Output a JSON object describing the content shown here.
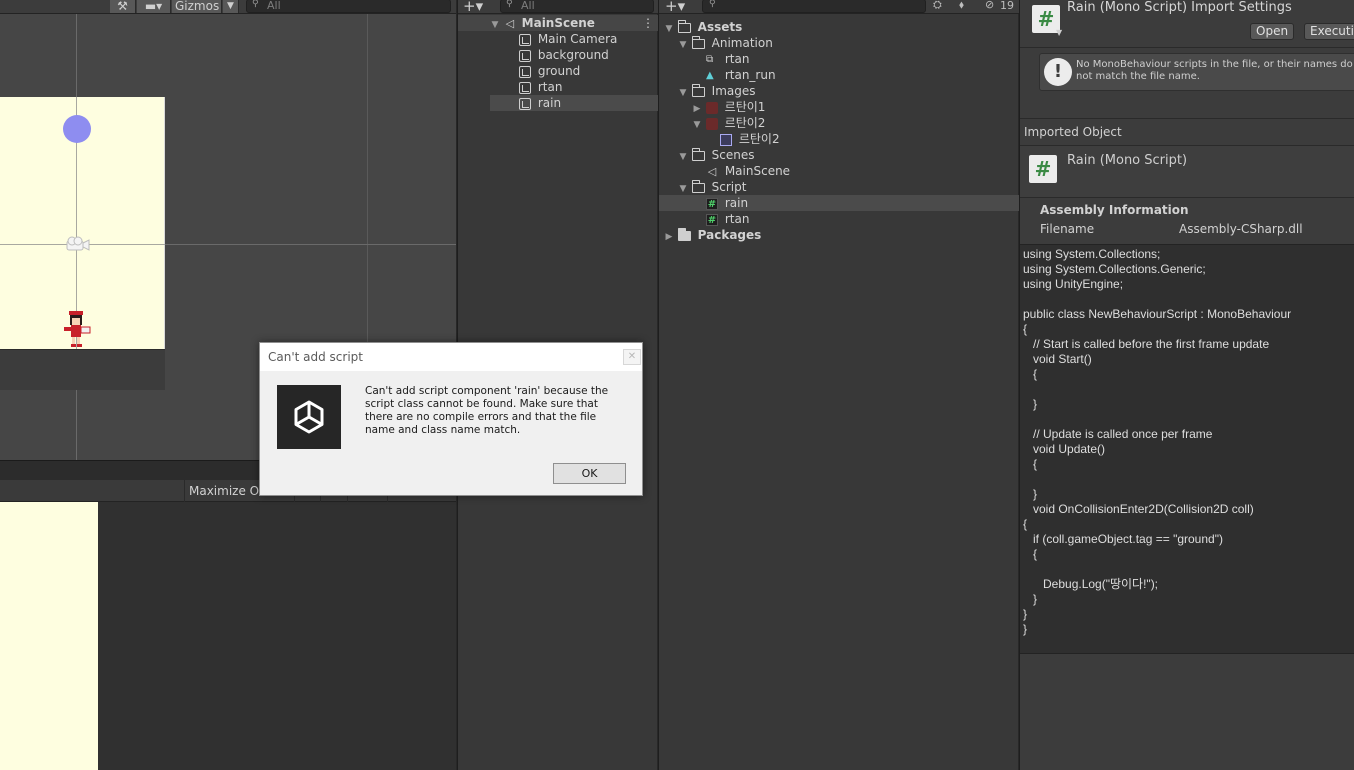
{
  "scene_toolbar": {
    "gizmos_label": "Gizmos",
    "search_placeholder": "All"
  },
  "game_toolbar": {
    "maximize_label": "Maximize On"
  },
  "hierarchy": {
    "search_placeholder": "All",
    "scene_name": "MainScene",
    "items": [
      {
        "label": "Main Camera"
      },
      {
        "label": "background"
      },
      {
        "label": "ground"
      },
      {
        "label": "rtan"
      },
      {
        "label": "rain"
      }
    ]
  },
  "project": {
    "hidden_count": "19",
    "tree": {
      "assets": "Assets",
      "animation": "Animation",
      "anim_rtan": "rtan",
      "anim_rtan_run": "rtan_run",
      "images": "Images",
      "img1": "르탄이1",
      "img2": "르탄이2",
      "img2_sprite": "르탄이2",
      "scenes": "Scenes",
      "mainscene": "MainScene",
      "script": "Script",
      "script_rain": "rain",
      "script_rtan": "rtan",
      "packages": "Packages"
    }
  },
  "inspector": {
    "title": "Rain (Mono Script) Import Settings",
    "open_label": "Open",
    "execution_label": "Execution",
    "warning": "No MonoBehaviour scripts in the file, or their names do not match the file name.",
    "imported_object_header": "Imported Object",
    "object_name": "Rain (Mono Script)",
    "assembly_header": "Assembly Information",
    "filename_label": "Filename",
    "filename_value": "Assembly-CSharp.dll",
    "code": "using System.Collections;\nusing System.Collections.Generic;\nusing UnityEngine;\n\npublic class NewBehaviourScript : MonoBehaviour\n{\n   // Start is called before the first frame update\n   void Start()\n   {\n\n   }\n\n   // Update is called once per frame\n   void Update()\n   {\n\n   }\n   void OnCollisionEnter2D(Collision2D coll)\n{\n   if (coll.gameObject.tag == \"ground\")\n   {\n\n      Debug.Log(\"땅이다!\");\n   }\n}\n}"
  },
  "dialog": {
    "title": "Can't add script",
    "message": "Can't add script component 'rain' because the script class cannot be found. Make sure that there are no compile errors and that the file name and class name match.",
    "ok_label": "OK",
    "close_glyph": "✕"
  }
}
